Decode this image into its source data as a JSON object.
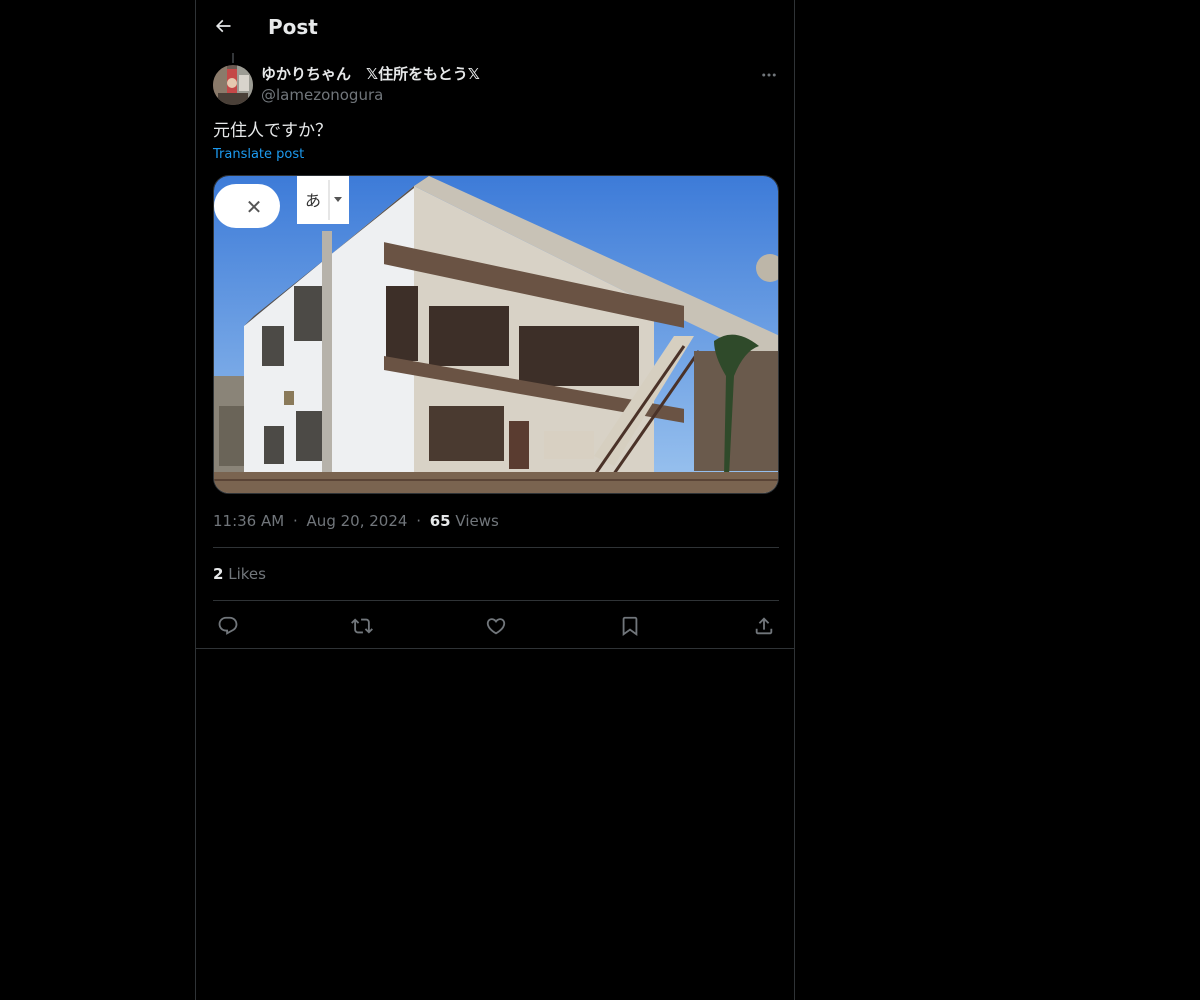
{
  "header": {
    "title": "Post"
  },
  "post": {
    "display_name": "ゆかりちゃん　𝕏住所をもとう𝕏",
    "handle": "@lamezonogura",
    "text": "元住人ですか？",
    "translate_label": "Translate post",
    "time": "11:36 AM",
    "date": "Aug 20, 2024",
    "views_count": "65",
    "views_label": "Views",
    "likes_count": "2",
    "likes_label": "Likes",
    "separator": "·"
  },
  "media_overlay": {
    "ime_char": "あ",
    "close_glyph": "✕"
  },
  "icons": {
    "back": "arrow-left-icon",
    "more": "more-horizontal-icon",
    "reply": "reply-icon",
    "repost": "repost-icon",
    "like": "heart-icon",
    "bookmark": "bookmark-icon",
    "share": "share-icon"
  },
  "colors": {
    "background": "#000000",
    "text_primary": "#e7e9ea",
    "text_secondary": "#71767b",
    "link": "#1d9bf0",
    "border": "#2f3336"
  }
}
